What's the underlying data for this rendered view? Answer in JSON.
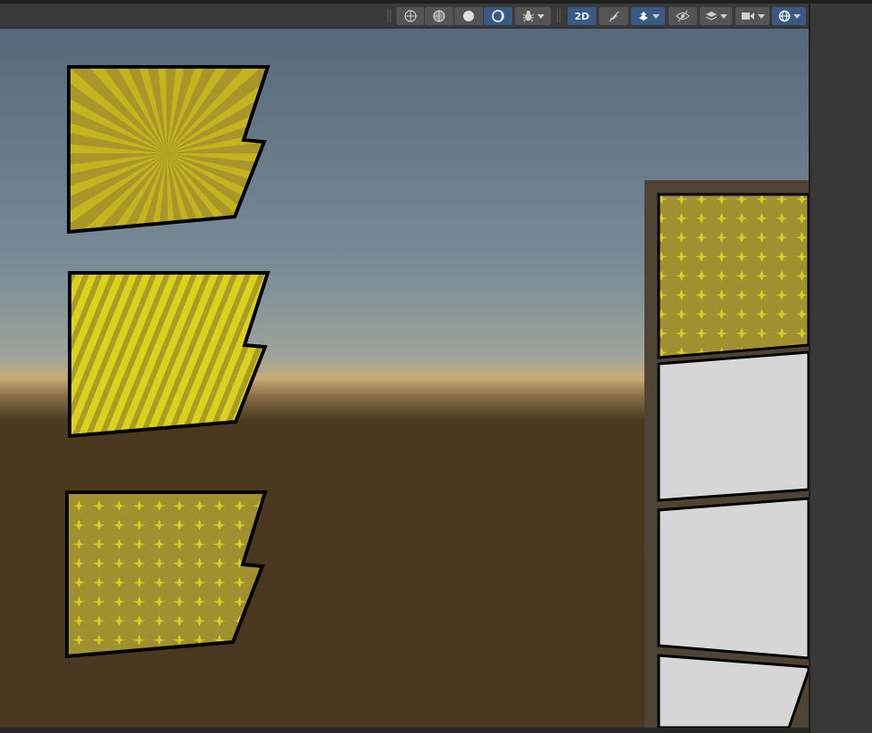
{
  "toolbar": {
    "two_d_label": "2D",
    "icons": [
      "shading-wireframe-icon",
      "shading-shaded-wireframe-icon",
      "shading-solid-icon",
      "shading-lit-icon",
      "debug-bug-icon",
      "audio-mute-icon",
      "effects-layers-icon",
      "hidden-visibility-icon",
      "layers-icon",
      "camera-icon",
      "gizmos-icon"
    ]
  },
  "scene": {
    "sky_color": "#5e6f7e",
    "horizon_color": "#c8aa74",
    "ground_color": "#4a391f",
    "panel_yellow": "#a8962a",
    "panel_bright_yellow": "#d9ce1f",
    "panel_white": "#d6d6d6",
    "outline_color": "#000000",
    "panels": [
      "sunburst-panel",
      "diagonal-stripes-panel",
      "dot-pattern-panel"
    ],
    "page_panels": [
      "dot-pattern-panel",
      "blank-panel",
      "blank-panel",
      "blank-panel"
    ]
  }
}
